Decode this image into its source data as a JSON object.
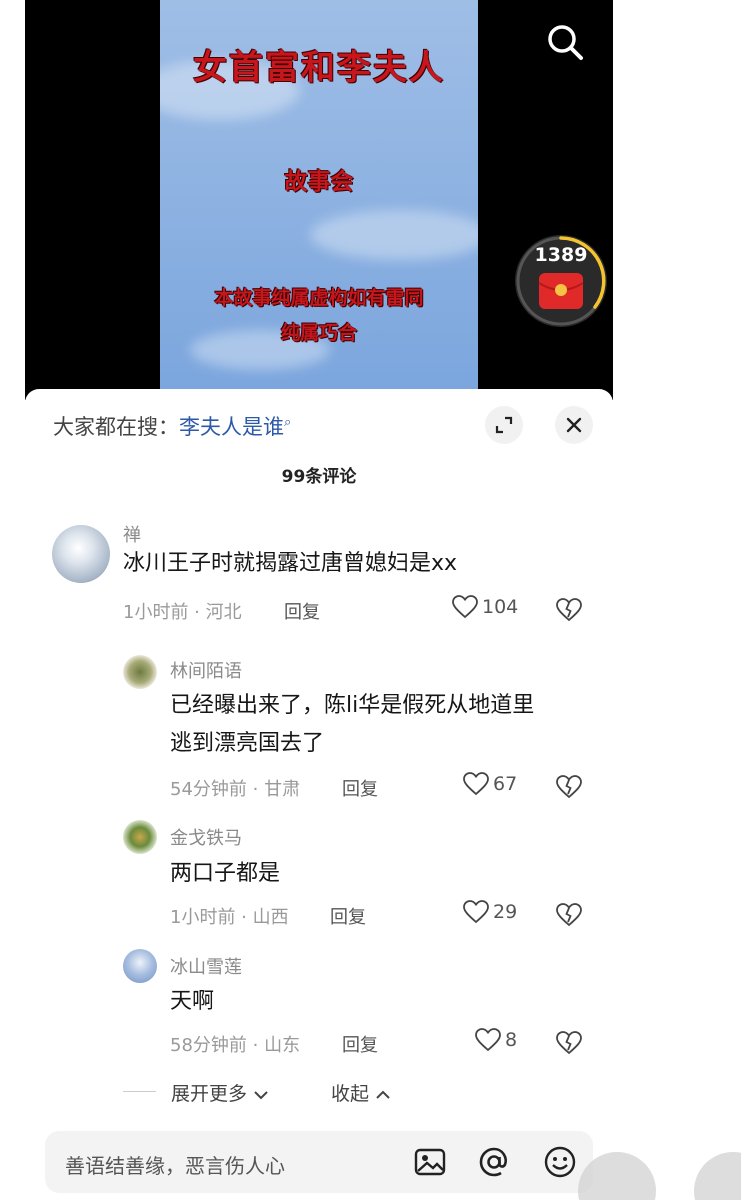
{
  "video": {
    "title": "女首富和李夫人",
    "subtitle": "故事会",
    "disclaimer_line1": "本故事纯属虚构如有雷同",
    "disclaimer_line2": "纯属巧合",
    "red_packet_count": "1389",
    "icons": {
      "search": "search-icon",
      "red_packet": "red-packet-icon"
    }
  },
  "sheet": {
    "search_prefix": "大家都在搜：",
    "search_term": "李夫人是谁",
    "comment_count": "99条评论",
    "icons": {
      "expand": "expand-icon",
      "close": "close-icon"
    }
  },
  "comments": [
    {
      "user": "禅",
      "text_lines": [
        "冰川王子时就揭露过唐曾媳妇是xx"
      ],
      "meta": "1小时前 · 河北",
      "reply": "回复",
      "likes": "104"
    },
    {
      "user": "林间陌语",
      "text_lines": [
        "已经曝出来了，陈li华是假死从地道里",
        "逃到漂亮国去了"
      ],
      "meta": "54分钟前 · 甘肃",
      "reply": "回复",
      "likes": "67"
    },
    {
      "user": "金戈铁马",
      "text_lines": [
        "两口子都是"
      ],
      "meta": "1小时前 · 山西",
      "reply": "回复",
      "likes": "29"
    },
    {
      "user": "冰山雪莲",
      "text_lines": [
        "天啊"
      ],
      "meta": "58分钟前 · 山东",
      "reply": "回复",
      "likes": "8"
    }
  ],
  "thread_controls": {
    "expand_more": "展开更多",
    "collapse": "收起"
  },
  "input": {
    "placeholder": "善语结善缘，恶言伤人心",
    "icons": {
      "image": "image-icon",
      "mention": "at-icon",
      "emoji": "emoji-icon"
    }
  },
  "colors": {
    "accent_link": "#2c5aa8",
    "video_text": "#c8161d",
    "ring": "#f4c430"
  }
}
